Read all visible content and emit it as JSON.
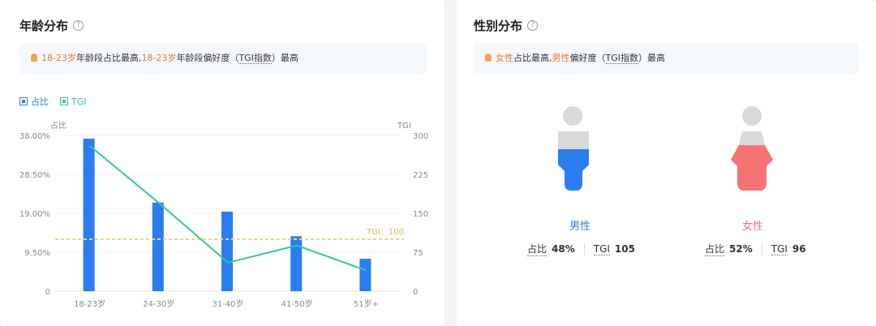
{
  "age_card": {
    "title": "年龄分布",
    "help": "?",
    "tip": {
      "seg1": "18-23岁",
      "seg2": "年龄段占比最高,",
      "seg3": "18-23岁",
      "seg4": "年龄段偏好度（",
      "seg5": "TGI指数",
      "seg6": "）最高"
    },
    "legend": [
      {
        "label": "占比",
        "color": "#2a7df0"
      },
      {
        "label": "TGI",
        "color": "#2ec9a4"
      }
    ]
  },
  "chart_data": {
    "type": "bar",
    "categories": [
      "18-23岁",
      "24-30岁",
      "31-40岁",
      "41-50岁",
      "51岁+"
    ],
    "series": [
      {
        "name": "占比",
        "type": "bar",
        "axis": "left",
        "values": [
          37.2,
          21.6,
          19.4,
          13.4,
          7.9
        ],
        "color": "#2a7df0"
      },
      {
        "name": "TGI",
        "type": "line",
        "axis": "right",
        "values": [
          280,
          170,
          55,
          88,
          40
        ],
        "color": "#2ec9a4"
      }
    ],
    "y_left": {
      "label": "占比",
      "ticks": [
        "0",
        "9.50%",
        "19.00%",
        "28.50%",
        "38.00%"
      ],
      "range": [
        0,
        38
      ]
    },
    "y_right": {
      "label": "TGI",
      "ticks": [
        "0",
        "75",
        "150",
        "225",
        "300"
      ],
      "range": [
        0,
        300
      ]
    },
    "reference_line": {
      "label": "TGI：100",
      "value": 100,
      "color": "#f3d27a"
    },
    "grid": true
  },
  "gender_card": {
    "title": "性别分布",
    "help": "?",
    "tip": {
      "seg1": "女性",
      "seg2": "占比最高,",
      "seg3": "男性",
      "seg4": "偏好度（",
      "seg5": "TGI指数",
      "seg6": "）最高"
    },
    "male": {
      "label": "男性",
      "share_label": "占比",
      "share": "48%",
      "tgi_label": "TGI",
      "tgi": "105",
      "fill_fraction": 0.48,
      "color": "#2a7df0"
    },
    "female": {
      "label": "女性",
      "share_label": "占比",
      "share": "52%",
      "tgi_label": "TGI",
      "tgi": "96",
      "fill_fraction": 0.52,
      "color": "#f47474"
    }
  }
}
